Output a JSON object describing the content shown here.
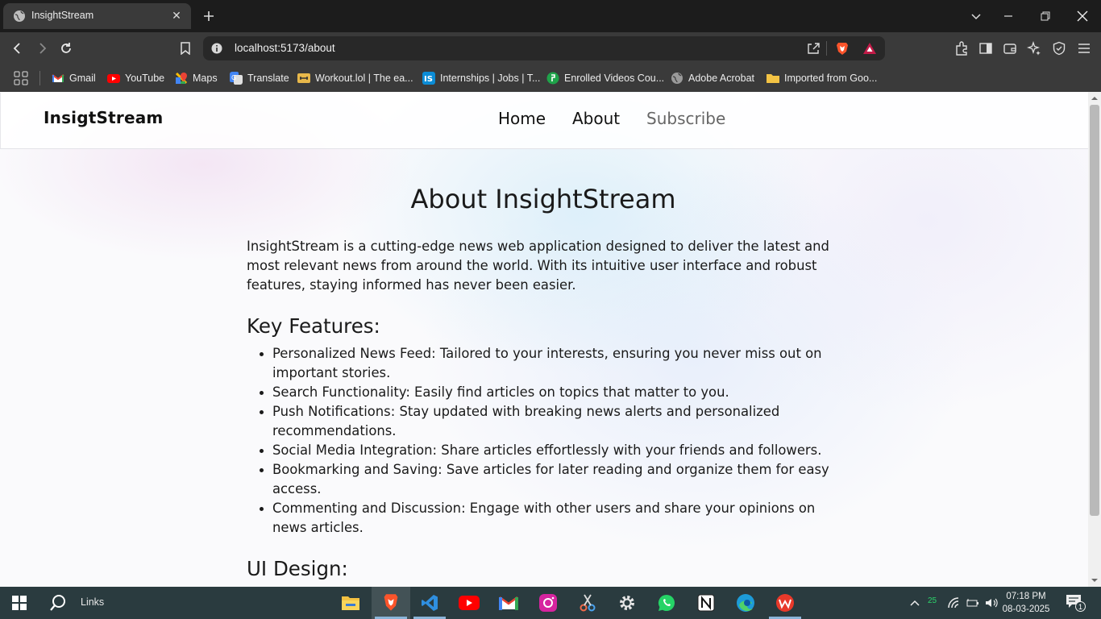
{
  "browser": {
    "tab_title": "InsightStream",
    "url": "localhost:5173/about",
    "bookmarks": [
      {
        "label": "Gmail",
        "color": "#ea4335"
      },
      {
        "label": "YouTube",
        "color": "#ff0000"
      },
      {
        "label": "Maps",
        "color": "#34a853"
      },
      {
        "label": "Translate",
        "color": "#4285f4"
      },
      {
        "label": "Workout.lol | The ea...",
        "color": "#e8b84a"
      },
      {
        "label": "Internships | Jobs | T...",
        "color": "#0b8cd6"
      },
      {
        "label": "Enrolled Videos Cou...",
        "color": "#1fa34a"
      },
      {
        "label": "Adobe Acrobat",
        "color": "#9a9a9a"
      },
      {
        "label": "Imported from Goo...",
        "color": "#f3c344"
      }
    ]
  },
  "site": {
    "brand": "InsigtStream",
    "nav": {
      "home": "Home",
      "about": "About",
      "subscribe": "Subscribe"
    },
    "title": "About InsightStream",
    "intro": "InsightStream is a cutting-edge news web application designed to deliver the latest and most relevant news from around the world. With its intuitive user interface and robust features, staying informed has never been easier.",
    "features_heading": "Key Features:",
    "features": [
      "Personalized News Feed: Tailored to your interests, ensuring you never miss out on important stories.",
      "Search Functionality: Easily find articles on topics that matter to you.",
      "Push Notifications: Stay updated with breaking news alerts and personalized recommendations.",
      "Social Media Integration: Share articles effortlessly with your friends and followers.",
      "Bookmarking and Saving: Save articles for later reading and organize them for easy access.",
      "Commenting and Discussion: Engage with other users and share your opinions on news articles."
    ],
    "ui_heading": "UI Design:"
  },
  "taskbar": {
    "search_label": "Links",
    "time": "07:18 PM",
    "date": "08-03-2025",
    "weather": "25",
    "notification_count": "1"
  }
}
